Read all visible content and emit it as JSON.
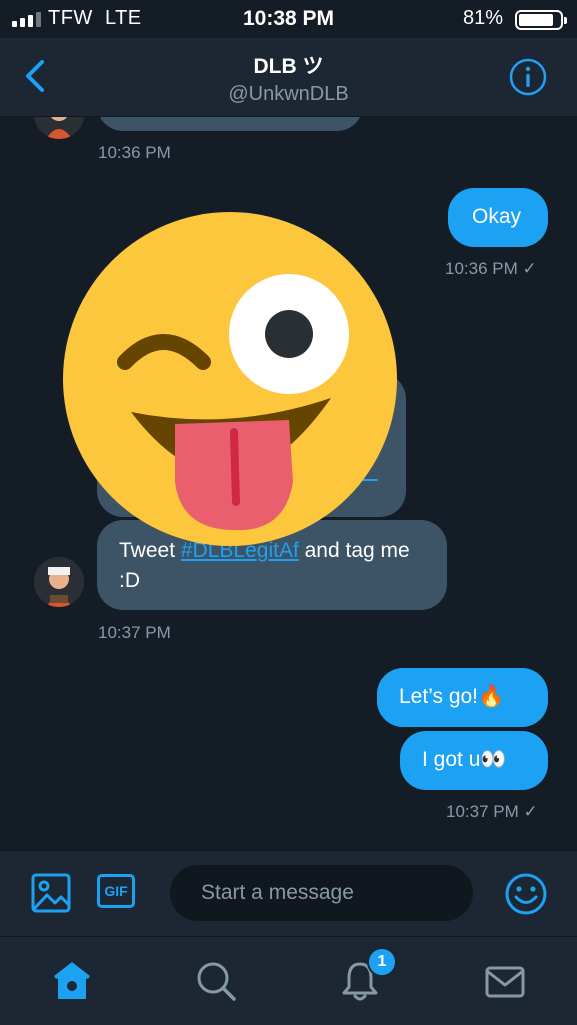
{
  "status": {
    "carrier": "TFW",
    "network": "LTE",
    "time": "10:38 PM",
    "battery": "81%"
  },
  "header": {
    "name": "DLB ツ",
    "handle": "@UnkwnDLB"
  },
  "messages": {
    "ts_1": "10:36 PM",
    "okay": "Okay",
    "ts_2": "10:36 PM",
    "tweet_prefix": "Tweet ",
    "tweet_hashtag": "#DLBLegitAf",
    "tweet_suffix": " and tag me :D",
    "ts_3": "10:37 PM",
    "letsgo": "Let’s go!🔥",
    "igot": "I got u👀",
    "ts_4": "10:37 PM",
    "check": "✓"
  },
  "composer": {
    "placeholder": "Start a message",
    "gif_label": "GIF"
  },
  "tabs": {
    "notifications_badge": "1"
  },
  "icons": {
    "back": "chevron-left-icon",
    "info": "info-icon",
    "image": "image-icon",
    "gif": "gif-icon",
    "emoji": "emoji-icon",
    "home": "home-icon",
    "search": "search-icon",
    "notifications": "bell-icon",
    "messages": "mail-icon"
  },
  "colors": {
    "accent": "#1da1f2",
    "background": "#141d26",
    "incoming_bubble": "#3d5366",
    "bar": "#1c2733",
    "muted": "#8899a6"
  }
}
